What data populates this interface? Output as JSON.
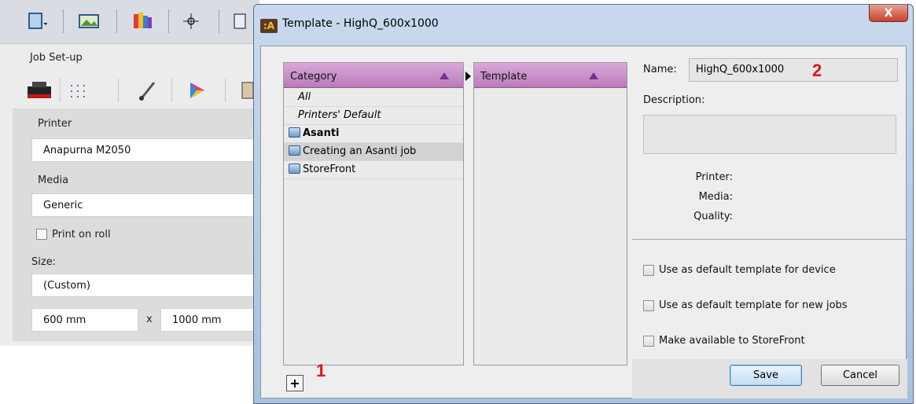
{
  "background_app": {
    "section_title": "Job Set-up",
    "printer_label": "Printer",
    "printer_value": "Anapurna M2050",
    "media_label": "Media",
    "media_value": "Generic",
    "print_on_roll_label": "Print on roll",
    "size_label": "Size:",
    "size_value": "(Custom)",
    "width_value": "600 mm",
    "times_label": "x",
    "height_value": "1000 mm"
  },
  "dialog": {
    "title": "Template - HighQ_600x1000",
    "app_icon_text": ":A",
    "close_symbol": "X",
    "category_header": "Category",
    "template_header": "Template",
    "categories": [
      {
        "label": "All",
        "style": "italic"
      },
      {
        "label": "Printers' Default",
        "style": "italic"
      },
      {
        "label": "Asanti",
        "style": "bold",
        "icon": "folder-icon"
      },
      {
        "label": "Creating an Asanti job",
        "style": "selected",
        "icon": "folder-icon"
      },
      {
        "label": "StoreFront",
        "style": "normal",
        "icon": "folder-icon"
      }
    ],
    "add_button_label": "+",
    "name_label": "Name:",
    "name_value": "HighQ_600x1000",
    "description_label": "Description:",
    "printer_label": "Printer:",
    "media_label": "Media:",
    "quality_label": "Quality:",
    "checkbox_default_device": "Use as default template for device",
    "checkbox_default_new_jobs": "Use as default template for new jobs",
    "checkbox_storefront": "Make available to StoreFront",
    "save_label": "Save",
    "cancel_label": "Cancel"
  },
  "callouts": {
    "one": "1",
    "two": "2"
  },
  "colors": {
    "header_purple": "#c08bc0",
    "sort_triangle": "#7a2f8c",
    "callout_red": "#e0141c",
    "title_bar": "#b7cde8"
  }
}
